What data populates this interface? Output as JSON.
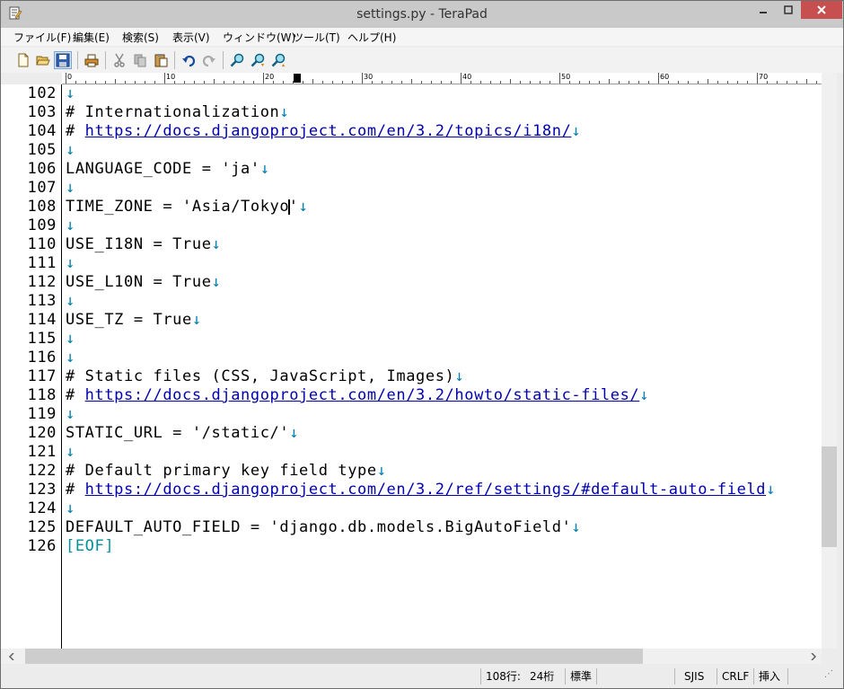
{
  "window": {
    "title": "settings.py - TeraPad"
  },
  "menu": [
    "ファイル(F)",
    "編集(E)",
    "検索(S)",
    "表示(V)",
    "ウィンドウ(W)",
    "ツール(T)",
    "ヘルプ(H)"
  ],
  "toolbar_icons": [
    "new-file-icon",
    "open-folder-icon",
    "save-icon",
    "print-icon",
    "cut-icon",
    "copy-icon",
    "paste-icon",
    "undo-icon",
    "redo-icon",
    "find-icon",
    "find-next-icon",
    "find-previous-icon"
  ],
  "ruler": {
    "labels": [
      "0",
      "10",
      "20",
      "30",
      "40",
      "50",
      "60",
      "70"
    ]
  },
  "editor": {
    "caret_line": 108,
    "lines": [
      {
        "num": "102",
        "segments": []
      },
      {
        "num": "103",
        "segments": [
          {
            "t": "# Internationalization",
            "c": "text"
          }
        ]
      },
      {
        "num": "104",
        "segments": [
          {
            "t": "# ",
            "c": "text"
          },
          {
            "t": "https://docs.djangoproject.com/en/3.2/topics/i18n/",
            "c": "url"
          }
        ]
      },
      {
        "num": "105",
        "segments": []
      },
      {
        "num": "106",
        "segments": [
          {
            "t": "LANGUAGE_CODE = 'ja'",
            "c": "text"
          }
        ]
      },
      {
        "num": "107",
        "segments": []
      },
      {
        "num": "108",
        "segments": [
          {
            "t": "TIME_ZONE = 'Asia/Tokyo",
            "c": "text"
          },
          {
            "t": "",
            "c": "caret"
          },
          {
            "t": "'",
            "c": "text"
          }
        ]
      },
      {
        "num": "109",
        "segments": []
      },
      {
        "num": "110",
        "segments": [
          {
            "t": "USE_I18N = True",
            "c": "text"
          }
        ]
      },
      {
        "num": "111",
        "segments": []
      },
      {
        "num": "112",
        "segments": [
          {
            "t": "USE_L10N = True",
            "c": "text"
          }
        ]
      },
      {
        "num": "113",
        "segments": []
      },
      {
        "num": "114",
        "segments": [
          {
            "t": "USE_TZ = True",
            "c": "text"
          }
        ]
      },
      {
        "num": "115",
        "segments": []
      },
      {
        "num": "116",
        "segments": []
      },
      {
        "num": "117",
        "segments": [
          {
            "t": "# Static files (CSS, JavaScript, Images)",
            "c": "text"
          }
        ]
      },
      {
        "num": "118",
        "segments": [
          {
            "t": "# ",
            "c": "text"
          },
          {
            "t": "https://docs.djangoproject.com/en/3.2/howto/static-files/",
            "c": "url"
          }
        ]
      },
      {
        "num": "119",
        "segments": []
      },
      {
        "num": "120",
        "segments": [
          {
            "t": "STATIC_URL = '/static/'",
            "c": "text"
          }
        ]
      },
      {
        "num": "121",
        "segments": []
      },
      {
        "num": "122",
        "segments": [
          {
            "t": "# Default primary key field type",
            "c": "text"
          }
        ]
      },
      {
        "num": "123",
        "segments": [
          {
            "t": "# ",
            "c": "text"
          },
          {
            "t": "https://docs.djangoproject.com/en/3.2/ref/settings/#default-auto-field",
            "c": "url"
          }
        ]
      },
      {
        "num": "124",
        "segments": []
      },
      {
        "num": "125",
        "segments": [
          {
            "t": "DEFAULT_AUTO_FIELD = 'django.db.models.BigAutoField'",
            "c": "text"
          }
        ]
      },
      {
        "num": "126",
        "segments": [
          {
            "t": "[EOF]",
            "c": "eof"
          }
        ]
      }
    ],
    "return_mark": "↓"
  },
  "status": {
    "line": "108行:",
    "col": "24桁",
    "mode": "標準",
    "encoding": "SJIS",
    "newline": "CRLF",
    "insert": "挿入"
  },
  "colors": {
    "url": "#0000b0",
    "return_mark": "#0080b0",
    "eof": "#0090a0",
    "close_button": "#c74f4f"
  }
}
